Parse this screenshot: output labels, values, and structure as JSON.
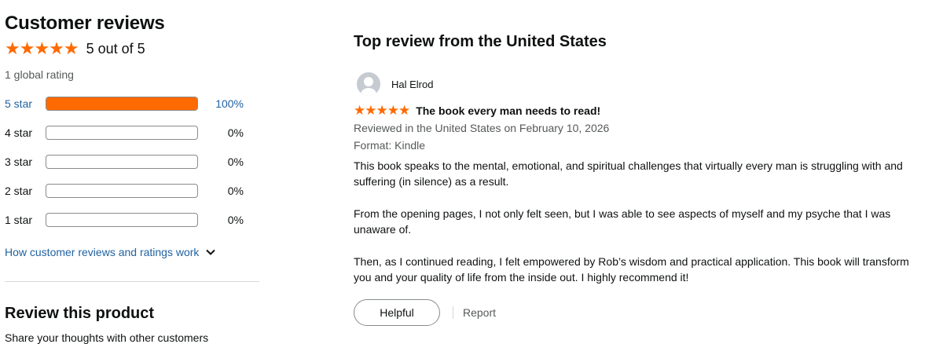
{
  "summary": {
    "heading": "Customer reviews",
    "stars": "★★★★★",
    "average_text": "5 out of 5",
    "global_rating": "1 global rating"
  },
  "histogram": [
    {
      "label": "5 star",
      "percent_text": "100%",
      "fraction": 1.0,
      "active": true
    },
    {
      "label": "4 star",
      "percent_text": "0%",
      "fraction": 0,
      "active": false
    },
    {
      "label": "3 star",
      "percent_text": "0%",
      "fraction": 0,
      "active": false
    },
    {
      "label": "2 star",
      "percent_text": "0%",
      "fraction": 0,
      "active": false
    },
    {
      "label": "1 star",
      "percent_text": "0%",
      "fraction": 0,
      "active": false
    }
  ],
  "how_link": "How customer reviews and ratings work",
  "review_product": {
    "heading": "Review this product",
    "share_text": "Share your thoughts with other customers"
  },
  "top_review": {
    "section_title": "Top review from the United States",
    "reviewer": "Hal Elrod",
    "stars": "★★★★★",
    "title": "The book every man needs to read!",
    "reviewed_in": "Reviewed in the United States on February 10, 2026",
    "format": "Format: Kindle",
    "paragraphs": [
      "This book speaks to the mental, emotional, and spiritual challenges that virtually every man is struggling with and suffering (in silence) as a result.",
      "From the opening pages, I not only felt seen, but I was able to see aspects of myself and my psyche that I was unaware of.",
      "Then, as I continued reading, I felt empowered by Rob’s wisdom and practical application. This book will transform you and your quality of life from the inside out. I highly recommend it!"
    ],
    "helpful_label": "Helpful",
    "report_label": "Report"
  },
  "colors": {
    "star": "#ff6a00",
    "link": "#2162a1",
    "muted": "#565959"
  }
}
